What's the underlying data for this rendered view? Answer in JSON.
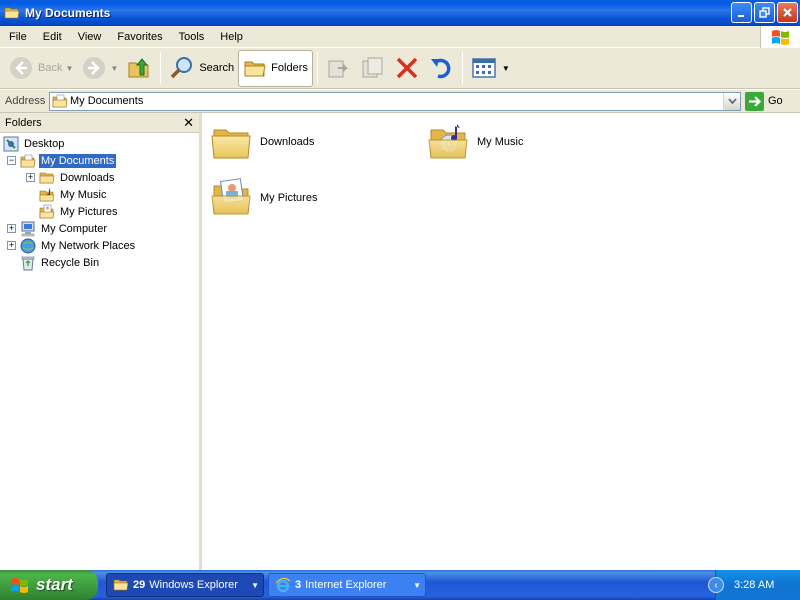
{
  "window": {
    "title": "My Documents"
  },
  "menu": [
    "File",
    "Edit",
    "View",
    "Favorites",
    "Tools",
    "Help"
  ],
  "toolbar": {
    "back": "Back",
    "search": "Search",
    "folders": "Folders"
  },
  "address": {
    "label": "Address",
    "value": "My Documents",
    "go": "Go"
  },
  "folders_pane": {
    "title": "Folders",
    "tree": [
      {
        "label": "Desktop",
        "level": 0,
        "expander": "",
        "icon": "desktop-icon"
      },
      {
        "label": "My Documents",
        "level": 0,
        "expander": "−",
        "icon": "my-documents-icon",
        "selected": true
      },
      {
        "label": "Downloads",
        "level": 1,
        "expander": "+",
        "icon": "folder-icon"
      },
      {
        "label": "My Music",
        "level": 1,
        "expander": "",
        "icon": "music-folder-icon"
      },
      {
        "label": "My Pictures",
        "level": 1,
        "expander": "",
        "icon": "pictures-folder-icon"
      },
      {
        "label": "My Computer",
        "level": 0,
        "expander": "+",
        "icon": "computer-icon"
      },
      {
        "label": "My Network Places",
        "level": 0,
        "expander": "+",
        "icon": "network-icon"
      },
      {
        "label": "Recycle Bin",
        "level": 0,
        "expander": "",
        "icon": "recycle-bin-icon"
      }
    ]
  },
  "content": {
    "items": [
      {
        "label": "Downloads",
        "icon": "folder-icon"
      },
      {
        "label": "My Music",
        "icon": "music-folder-icon"
      },
      {
        "label": "My Pictures",
        "icon": "pictures-folder-icon"
      }
    ]
  },
  "taskbar": {
    "start": "start",
    "tasks": [
      {
        "count": "29",
        "label": "Windows Explorer",
        "pressed": true
      },
      {
        "count": "3",
        "label": "Internet Explorer",
        "pressed": false
      }
    ],
    "clock": "3:28 AM"
  }
}
